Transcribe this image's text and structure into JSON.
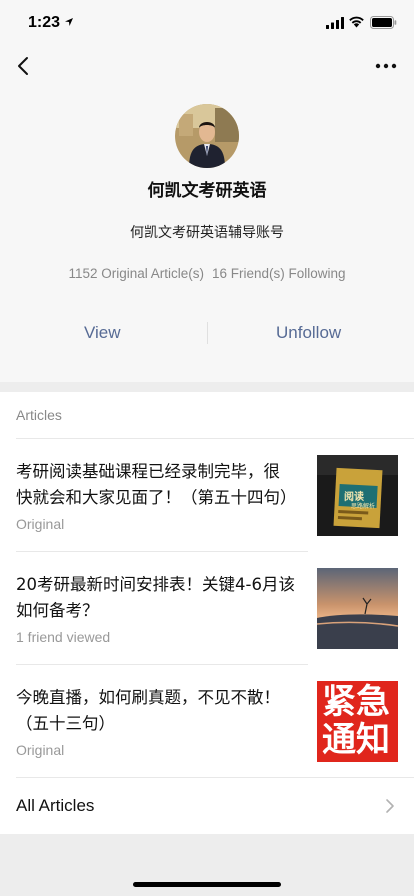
{
  "status_bar": {
    "time": "1:23"
  },
  "profile": {
    "name": "何凯文考研英语",
    "description": "何凯文考研英语辅导账号",
    "articles_count": "1152 Original Article(s)",
    "following_count": "16 Friend(s) Following",
    "view_label": "View",
    "unfollow_label": "Unfollow"
  },
  "articles": {
    "header": "Articles",
    "items": [
      {
        "title": "考研阅读基础课程已经录制完毕，很快就会和大家见面了！（第五十四句）",
        "meta": "Original",
        "thumb_text_top": "阅读",
        "thumb_text_bottom": "思路解析"
      },
      {
        "title": "20考研最新时间安排表！关键4-6月该如何备考？",
        "meta": "1 friend viewed"
      },
      {
        "title": "今晚直播，如何刷真题，不见不散！（五十三句）",
        "meta": "Original",
        "thumb_text_top": "紧急",
        "thumb_text_bottom": "通知"
      }
    ],
    "all_label": "All Articles"
  },
  "colors": {
    "link": "#576b95",
    "header_bg": "#f7f7f7",
    "notice_red": "#e0261c"
  },
  "icons": [
    "back-arrow-icon",
    "more-icon",
    "chevron-right-icon",
    "signal-icon",
    "wifi-icon",
    "battery-icon",
    "location-arrow-icon"
  ]
}
